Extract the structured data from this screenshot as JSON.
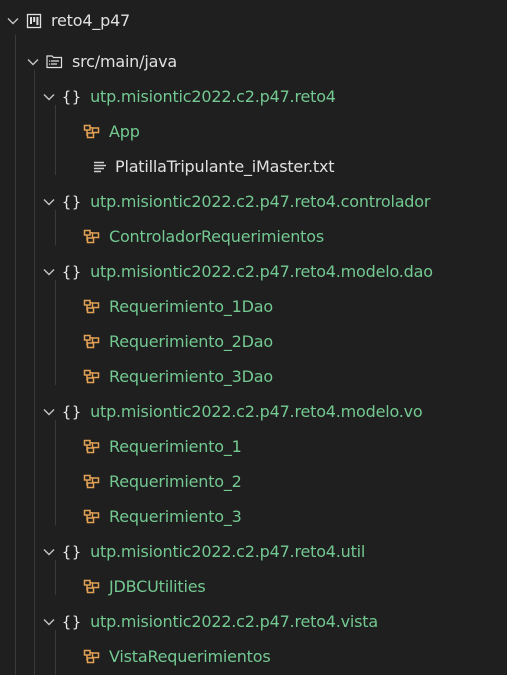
{
  "project": {
    "name": "reto4_p47",
    "icon": "project-board-icon",
    "source_folder": {
      "name": "src/main/java",
      "icon": "source-folder-icon"
    }
  },
  "packages": [
    {
      "name": "utp.misiontic2022.c2.p47.reto4",
      "icon": "package-braces-icon",
      "children": [
        {
          "name": "App",
          "icon": "class-icon"
        },
        {
          "name": "PlatillaTripulante_iMaster.txt",
          "icon": "text-file-icon"
        }
      ]
    },
    {
      "name": "utp.misiontic2022.c2.p47.reto4.controlador",
      "icon": "package-braces-icon",
      "children": [
        {
          "name": "ControladorRequerimientos",
          "icon": "class-icon"
        }
      ]
    },
    {
      "name": "utp.misiontic2022.c2.p47.reto4.modelo.dao",
      "icon": "package-braces-icon",
      "children": [
        {
          "name": "Requerimiento_1Dao",
          "icon": "class-icon"
        },
        {
          "name": "Requerimiento_2Dao",
          "icon": "class-icon"
        },
        {
          "name": "Requerimiento_3Dao",
          "icon": "class-icon"
        }
      ]
    },
    {
      "name": "utp.misiontic2022.c2.p47.reto4.modelo.vo",
      "icon": "package-braces-icon",
      "children": [
        {
          "name": "Requerimiento_1",
          "icon": "class-icon"
        },
        {
          "name": "Requerimiento_2",
          "icon": "class-icon"
        },
        {
          "name": "Requerimiento_3",
          "icon": "class-icon"
        }
      ]
    },
    {
      "name": "utp.misiontic2022.c2.p47.reto4.util",
      "icon": "package-braces-icon",
      "children": [
        {
          "name": "JDBCUtilities",
          "icon": "class-icon"
        }
      ]
    },
    {
      "name": "utp.misiontic2022.c2.p47.reto4.vista",
      "icon": "package-braces-icon",
      "children": [
        {
          "name": "VistaRequerimientos",
          "icon": "class-icon"
        }
      ]
    }
  ],
  "colors": {
    "background": "#1f1f1f",
    "package_text": "#73c991",
    "class_icon": "#e2a155",
    "default_text": "#e0e0e0",
    "indent_guide": "#3a3a3a"
  }
}
